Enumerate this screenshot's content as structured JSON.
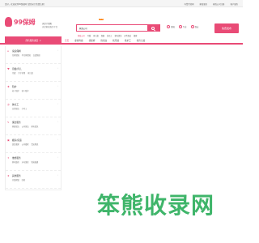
{
  "topbar": {
    "left": "您好，欢迎来到99保姆网 [请登录] [免费注册]",
    "right": [
      "有赞付款网",
      "家政服务",
      "家政公司注册",
      "客户服务"
    ]
  },
  "logo": {
    "text": "99保姆"
  },
  "city": {
    "name": "天津 [切换]",
    "note": "天津家政服务平台"
  },
  "search": {
    "tag": "家政公司",
    "placeholder": "",
    "hotwords": [
      "家政公司",
      "月嫂",
      "育儿嫂",
      "保姆",
      "钟点工",
      "家电清洗",
      "开荒保洁",
      "搬家"
    ]
  },
  "badges": {
    "new": "New"
  },
  "quick": {
    "items": [
      "保姆",
      "专业",
      "保安"
    ]
  },
  "cta": {
    "label": "免费发布"
  },
  "nav": {
    "category_button": "所有服务类目",
    "items": [
      "首页",
      "雇佣阿姨",
      "找保姆",
      "找家政",
      "找月嫂",
      "找护工",
      "找育儿嫂"
    ]
  },
  "categories": [
    {
      "title": "家庭保姆",
      "sub": [
        "住家保姆",
        "不住家保姆",
        "白班保姆"
      ]
    },
    {
      "title": "月嫂/育儿",
      "sub": [
        "月嫂",
        "月子护理",
        "育儿嫂"
      ]
    },
    {
      "title": "陪护",
      "sub": [
        "老人陪护",
        "病人陪护"
      ]
    },
    {
      "title": "钟点工",
      "sub": [
        "日常保洁",
        "小时工"
      ]
    },
    {
      "title": "保洁服务",
      "sub": [
        "家庭保洁",
        "公司保洁",
        "家电清洗"
      ]
    },
    {
      "title": "搬家/货运",
      "sub": [
        "居民搬家",
        "公司搬家",
        "货运物流"
      ]
    },
    {
      "title": "维修服务",
      "sub": [
        "家电维修",
        "水电维修",
        "管道疏通"
      ]
    },
    {
      "title": "其他服务",
      "sub": [
        "开锁换锁",
        "回收"
      ]
    }
  ],
  "watermark": {
    "text": "笨熊收录网"
  },
  "colors": {
    "brand": "#e94b76",
    "accent": "#ff7a00",
    "watermark": "#3fb56a"
  }
}
